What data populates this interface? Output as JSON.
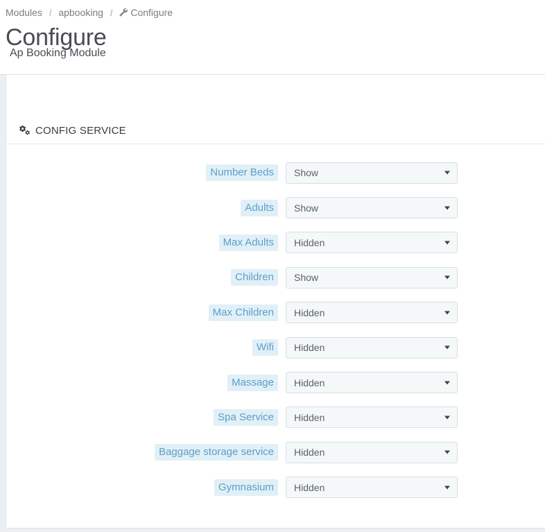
{
  "breadcrumb": {
    "items": [
      {
        "label": "Modules",
        "icon": null
      },
      {
        "label": "apbooking",
        "icon": null
      },
      {
        "label": "Configure",
        "icon": "wrench-icon"
      }
    ],
    "separator": "/"
  },
  "header": {
    "title": "Configure",
    "subtitle": "Ap Booking Module"
  },
  "panel": {
    "icon": "cogs-icon",
    "title": "CONFIG SERVICE",
    "rows": [
      {
        "label": "Number Beds",
        "value": "Show"
      },
      {
        "label": "Adults",
        "value": "Show"
      },
      {
        "label": "Max Adults",
        "value": "Hidden"
      },
      {
        "label": "Children",
        "value": "Show"
      },
      {
        "label": "Max Children",
        "value": "Hidden"
      },
      {
        "label": "Wifi",
        "value": "Hidden"
      },
      {
        "label": "Massage",
        "value": "Hidden"
      },
      {
        "label": "Spa Service",
        "value": "Hidden"
      },
      {
        "label": "Baggage storage service",
        "value": "Hidden"
      },
      {
        "label": "Gymnasium",
        "value": "Hidden"
      }
    ],
    "options": [
      "Show",
      "Hidden"
    ]
  },
  "colors": {
    "label_text": "#5d9ec9",
    "label_background": "#e1f0f7",
    "page_background": "#ffffff",
    "gutter": "#eceff1",
    "title_text": "#4a4a54",
    "breadcrumb_text": "#7c7b85"
  }
}
